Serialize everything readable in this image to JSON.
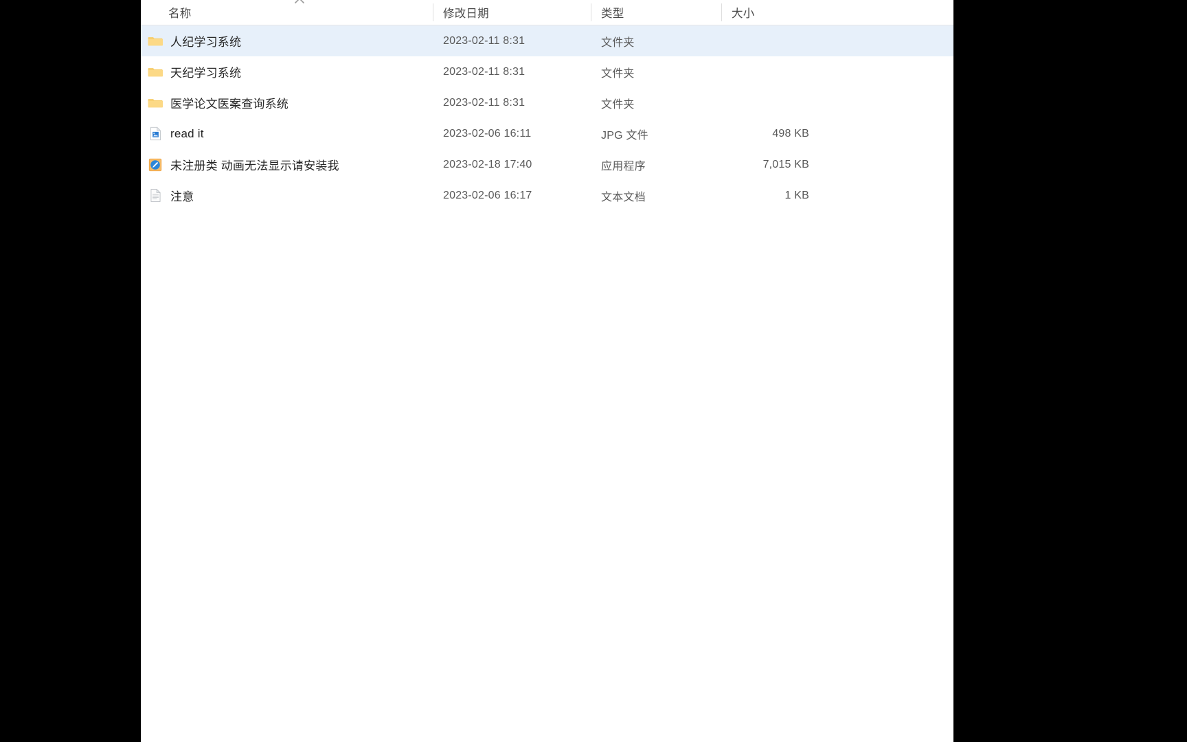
{
  "window": {
    "background_color": "#000000",
    "pane_background": "#ffffff",
    "selection_color": "#e7f0fa"
  },
  "columns": {
    "name": "名称",
    "date_modified": "修改日期",
    "type": "类型",
    "size": "大小",
    "sort_indicator_icon": "chevron-up-icon",
    "sorted_by": "名称"
  },
  "files": [
    {
      "icon": "folder-icon",
      "name": "人纪学习系统",
      "date_modified": "2023-02-11 8:31",
      "type": "文件夹",
      "size": "",
      "selected": true
    },
    {
      "icon": "folder-icon",
      "name": "天纪学习系统",
      "date_modified": "2023-02-11 8:31",
      "type": "文件夹",
      "size": "",
      "selected": false
    },
    {
      "icon": "folder-icon",
      "name": "医学论文医案查询系统",
      "date_modified": "2023-02-11 8:31",
      "type": "文件夹",
      "size": "",
      "selected": false
    },
    {
      "icon": "jpg-image-file-icon",
      "name": "read it",
      "date_modified": "2023-02-06 16:11",
      "type": "JPG 文件",
      "size": "498 KB",
      "selected": false
    },
    {
      "icon": "application-exe-icon",
      "name": "未注册类 动画无法显示请安装我",
      "date_modified": "2023-02-18 17:40",
      "type": "应用程序",
      "size": "7,015 KB",
      "selected": false
    },
    {
      "icon": "text-document-icon",
      "name": "注意",
      "date_modified": "2023-02-06 16:17",
      "type": "文本文档",
      "size": "1 KB",
      "selected": false
    }
  ]
}
